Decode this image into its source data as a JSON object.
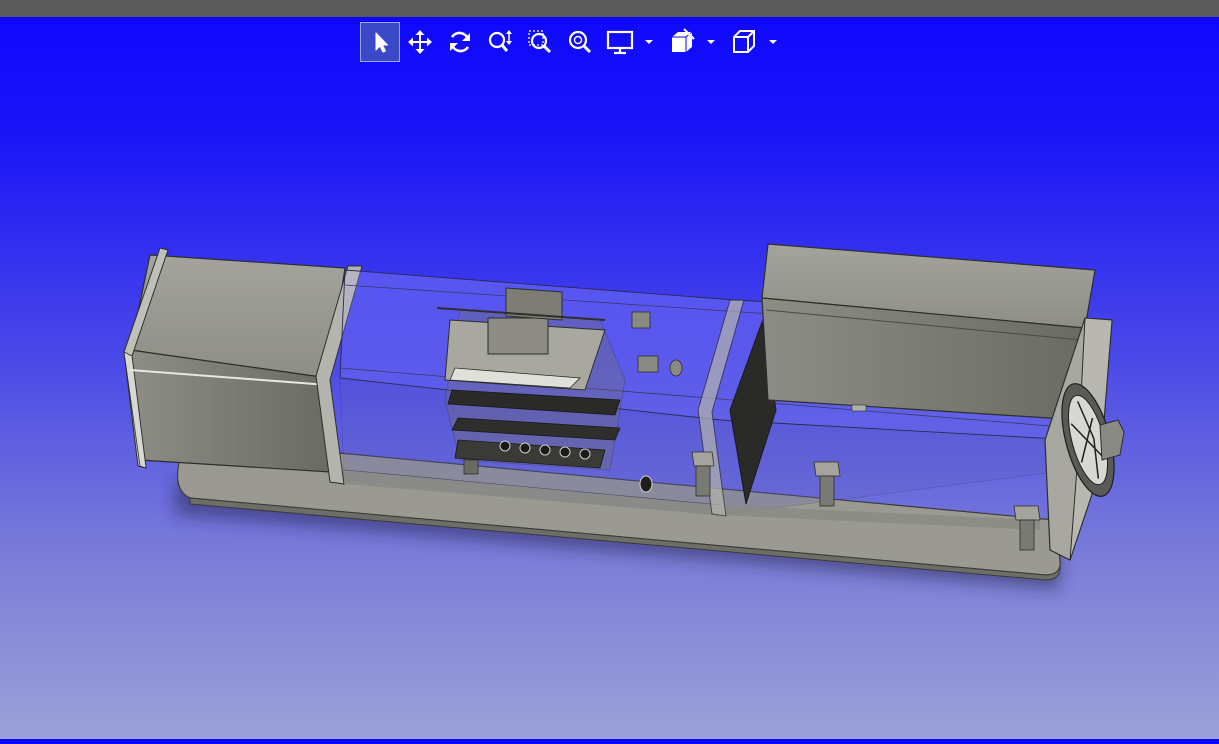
{
  "window": {
    "title_bar_color": "#5a5a5a"
  },
  "toolbar": {
    "buttons": [
      {
        "name": "select",
        "icon": "cursor-arrow-icon",
        "active": true
      },
      {
        "name": "pan",
        "icon": "move-arrows-icon",
        "active": false
      },
      {
        "name": "rotate",
        "icon": "rotate-icon",
        "active": false
      },
      {
        "name": "zoom",
        "icon": "zoom-updown-icon",
        "active": false
      },
      {
        "name": "zoom-window",
        "icon": "zoom-window-icon",
        "active": false
      },
      {
        "name": "zoom-fit",
        "icon": "zoom-fit-icon",
        "active": false
      },
      {
        "name": "display",
        "icon": "monitor-icon",
        "has_dropdown": true
      },
      {
        "name": "section",
        "icon": "section-cube-icon",
        "has_dropdown": true
      },
      {
        "name": "view-orientation",
        "icon": "cube-icon",
        "has_dropdown": true
      }
    ]
  },
  "viewport": {
    "background_top": "#0d06ff",
    "background_bottom": "#9aa2d8",
    "model": "cad-assembly-3d"
  }
}
